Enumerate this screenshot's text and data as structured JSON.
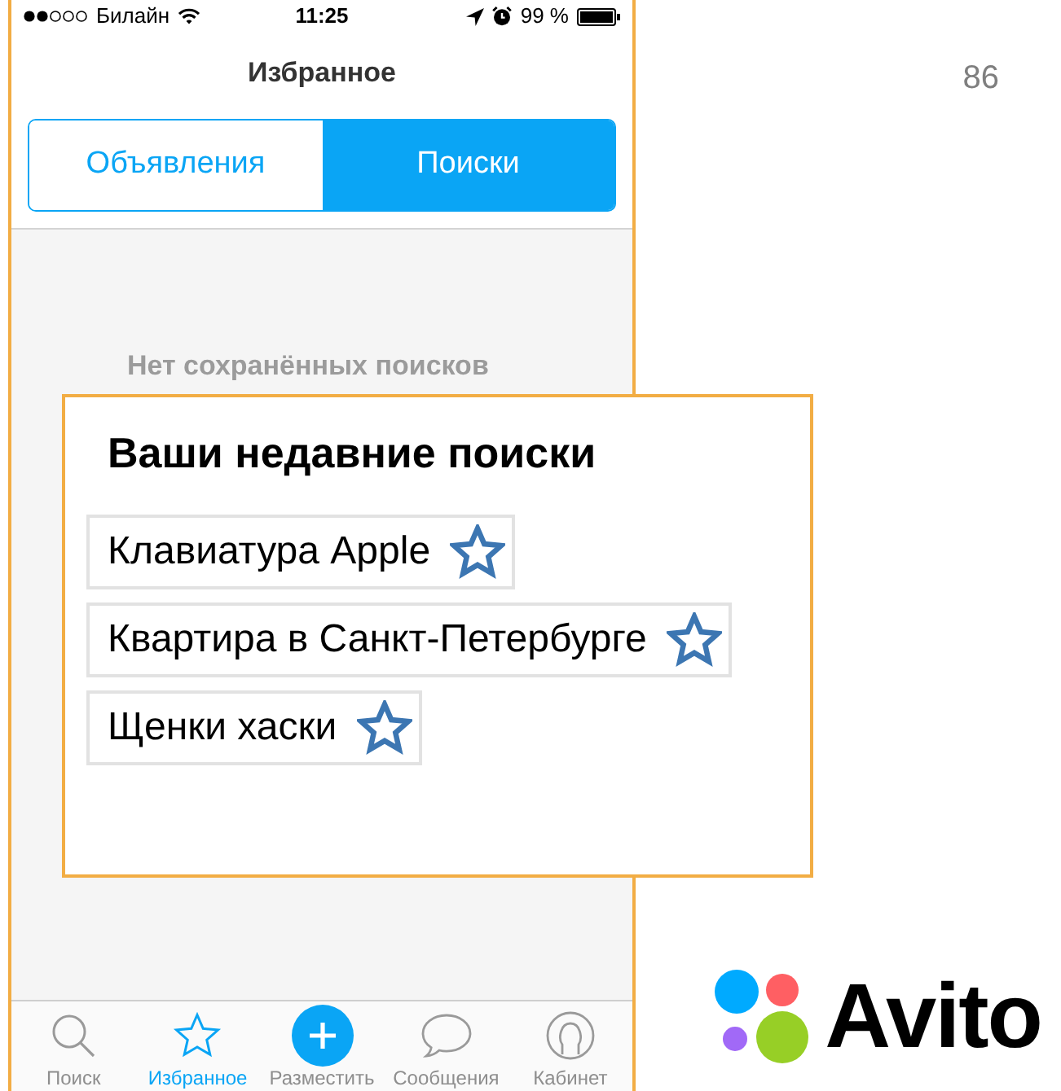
{
  "page_number": "86",
  "phone": {
    "status_bar": {
      "carrier": "Билайн",
      "time": "11:25",
      "battery": "99 %"
    },
    "title": "Избранное",
    "segments": [
      {
        "label": "Объявления",
        "selected": false
      },
      {
        "label": "Поиски",
        "selected": true
      }
    ],
    "empty_message": "Нет сохранённых поисков",
    "tab_bar": [
      {
        "label": "Поиск",
        "kind": "search",
        "selected": false
      },
      {
        "label": "Избранное",
        "kind": "favorites",
        "selected": true
      },
      {
        "label": "Разместить",
        "kind": "post",
        "selected": false
      },
      {
        "label": "Сообщения",
        "kind": "messages",
        "selected": false
      },
      {
        "label": "Кабинет",
        "kind": "profile",
        "selected": false
      }
    ]
  },
  "recent_searches": {
    "title": "Ваши недавние поиски",
    "items": [
      {
        "text": "Клавиатура Apple"
      },
      {
        "text": "Квартира в Санкт-Петербурге"
      },
      {
        "text": "Щенки хаски"
      }
    ]
  },
  "logo": {
    "wordmark": "Avito"
  }
}
